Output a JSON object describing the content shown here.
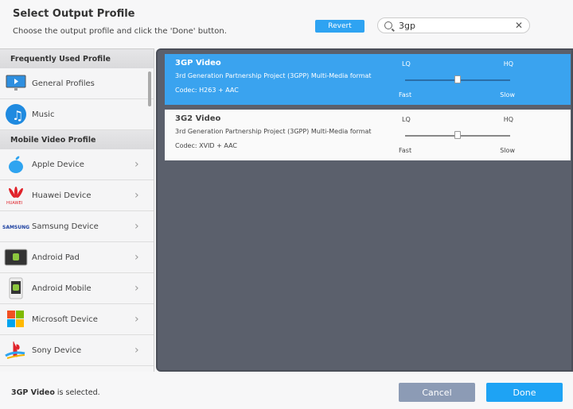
{
  "header": {
    "title": "Select Output Profile",
    "subtitle": "Choose the output profile and click the 'Done' button.",
    "revert_label": "Revert",
    "search_value": "3gp"
  },
  "sidebar": {
    "sections": [
      {
        "title": "Frequently Used Profile"
      },
      {
        "title": "Mobile Video Profile"
      }
    ],
    "frequent": [
      {
        "label": "General Profiles",
        "icon": "monitor-icon"
      },
      {
        "label": "Music",
        "icon": "music-icon"
      }
    ],
    "mobile": [
      {
        "label": "Apple Device",
        "icon": "apple-icon"
      },
      {
        "label": "Huawei Device",
        "icon": "huawei-icon",
        "logo_text": "HUAWEI"
      },
      {
        "label": "Samsung Device",
        "icon": "samsung-icon",
        "logo_text": "SAMSUNG"
      },
      {
        "label": "Android Pad",
        "icon": "android-pad-icon"
      },
      {
        "label": "Android Mobile",
        "icon": "android-mobile-icon"
      },
      {
        "label": "Microsoft Device",
        "icon": "microsoft-icon"
      },
      {
        "label": "Sony Device",
        "icon": "playstation-icon"
      }
    ]
  },
  "profiles": [
    {
      "name": "3GP Video",
      "description": "3rd Generation Partnership Project (3GPP) Multi-Media format",
      "codec": "Codec: H263 + AAC",
      "selected": true,
      "quality": 0.5
    },
    {
      "name": "3G2 Video",
      "description": "3rd Generation Partnership Project (3GPP) Multi-Media format",
      "codec": "Codec: XVID + AAC",
      "selected": false,
      "quality": 0.5
    }
  ],
  "slider_labels": {
    "lq": "LQ",
    "hq": "HQ",
    "fast": "Fast",
    "slow": "Slow"
  },
  "footer": {
    "selected_name": "3GP Video",
    "selected_suffix": " is selected.",
    "cancel_label": "Cancel",
    "done_label": "Done"
  },
  "colors": {
    "accent": "#3aa3ef",
    "panel": "#5b606c"
  }
}
